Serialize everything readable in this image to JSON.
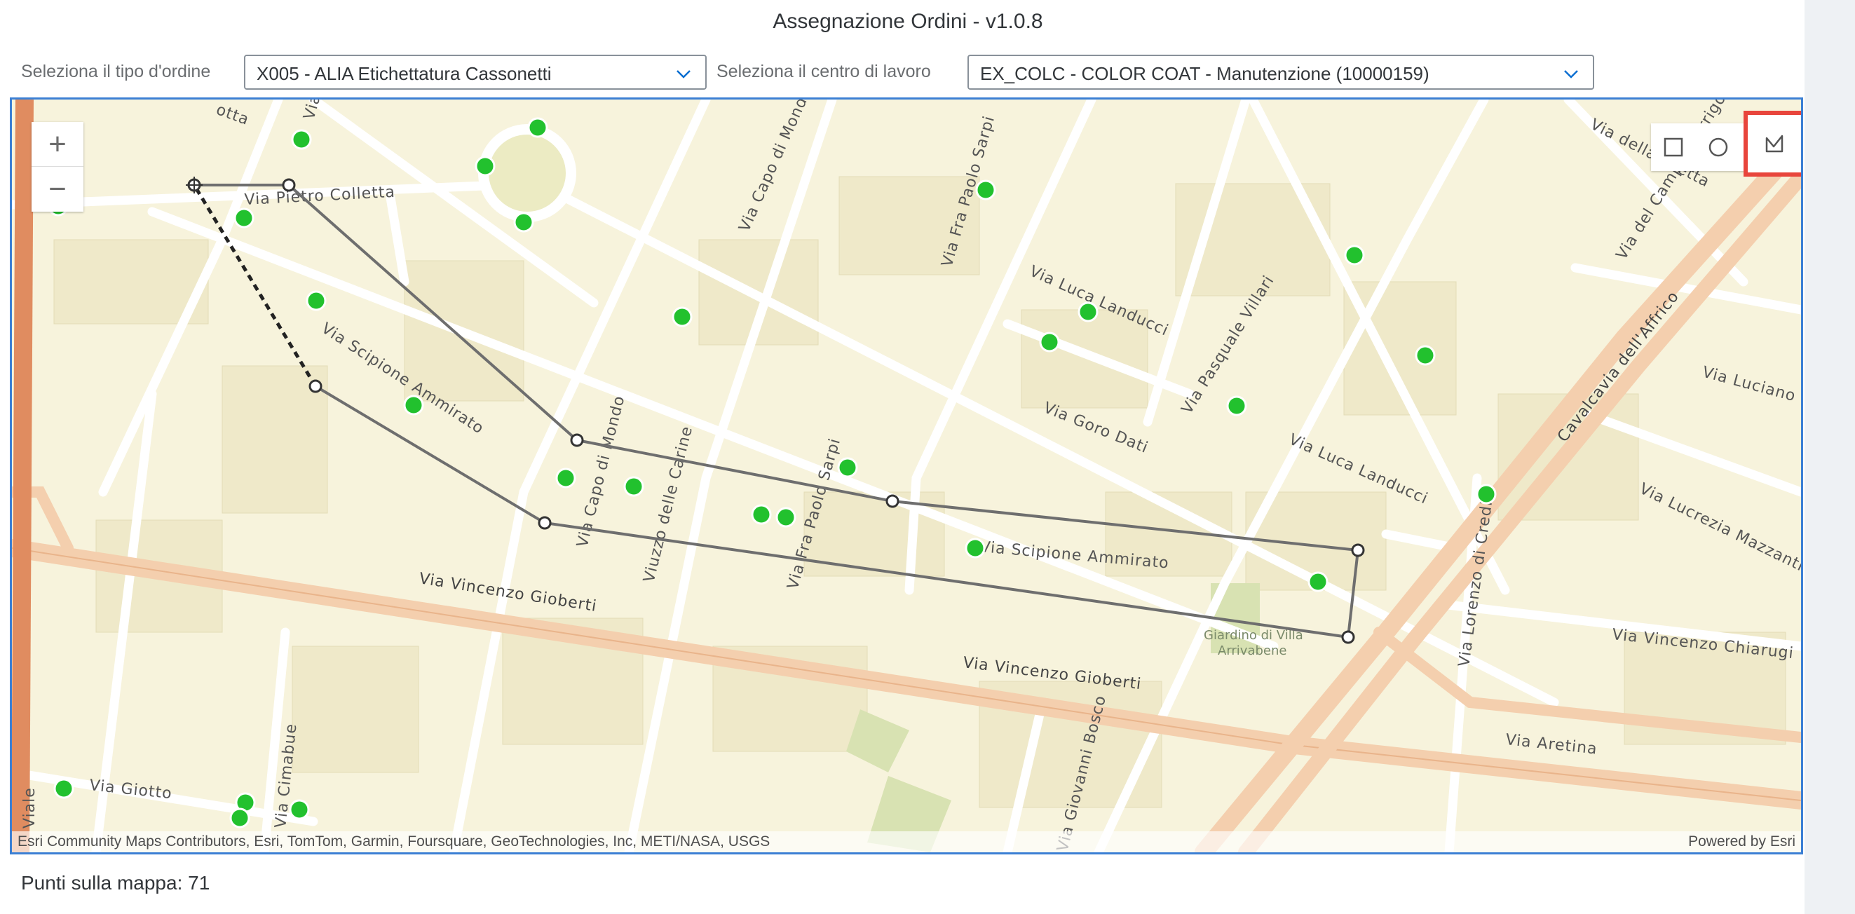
{
  "app": {
    "title": "Assegnazione Ordini - v1.0.8"
  },
  "filters": {
    "order_type_label": "Seleziona il tipo d'ordine",
    "order_type_value": "X005 - ALIA Etichettatura Cassonetti",
    "work_center_label": "Seleziona il centro di lavoro",
    "work_center_value": "EX_COLC - COLOR COAT - Manutenzione (10000159)"
  },
  "map": {
    "attribution": "Esri Community Maps Contributors, Esri, TomTom, Garmin, Foursquare, GeoTechnologies, Inc, METI/NASA, USGS",
    "powered_by": "Powered by Esri",
    "zoom_in": "+",
    "zoom_out": "−",
    "tools": [
      "rectangle-tool",
      "circle-tool",
      "polygon-tool"
    ],
    "selected_tool": "polygon-tool",
    "streets": {
      "colletta": "Via Pietro Colletta",
      "ammirato_w": "Via Scipione Ammirato",
      "ammirato_e": "Via Scipione Ammirato",
      "gioberti_w": "Via Vincenzo Gioberti",
      "gioberti_e": "Via Vincenzo Gioberti",
      "capo_mondo_n": "Via Capo di Mondo",
      "capo_mondo_s": "Via Capo di Mondo",
      "sarpi_n": "Via Fra Paolo Sarpi",
      "sarpi_s": "Via Fra Paolo Sarpi",
      "landucci_n": "Via Luca Landucci",
      "landucci_s": "Via Luca Landucci",
      "villari": "Via Pasquale Villari",
      "goro_dati": "Via Goro Dati",
      "cavalcavia": "Cavalcavia dell'Affrico",
      "luciano": "Via Luciano",
      "lucrezia": "Via Lucrezia Mazzanti",
      "chiarugi": "Via Vincenzo Chiarugi",
      "aretina": "Via Aretina",
      "credi": "Via Lorenzo di Credi",
      "cimabue": "Via Cimabue",
      "giotto": "Via Giotto",
      "carine": "Viuzzo delle Carine",
      "campo_arrigo": "Via del Campo d'Arrigo",
      "giardino": "Giardino di Villa",
      "giardino2": "Arrivabene",
      "viale": "Viale",
      "bosco": "Via Giovanni Bosco",
      "dalla_vi": "Via della Piletta",
      "viaN": "Via",
      "sotta": "otta"
    },
    "colors": {
      "points": "#22c12e",
      "polygon": "#6e6e6e",
      "accent": "#3b7fd4",
      "highlight": "#e8453c"
    }
  },
  "footer": {
    "points_text": "Punti sulla mappa: 71"
  }
}
